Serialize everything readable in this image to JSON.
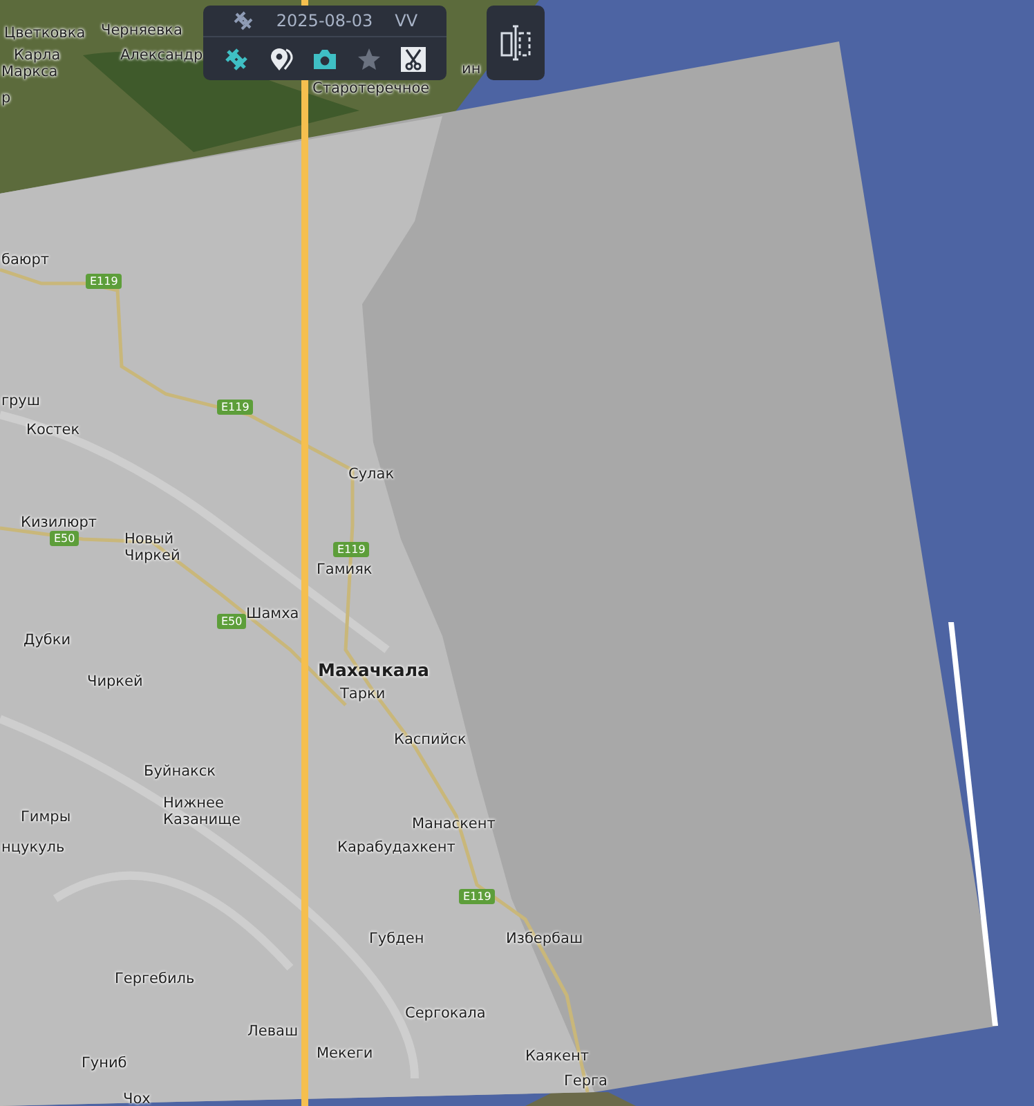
{
  "toolbar": {
    "date": "2025-08-03",
    "polarization": "VV",
    "tools": [
      {
        "kind": "satellite",
        "on": true,
        "disabled": false
      },
      {
        "kind": "pins",
        "on": false,
        "disabled": false
      },
      {
        "kind": "camera",
        "on": true,
        "disabled": false
      },
      {
        "kind": "star",
        "on": false,
        "disabled": true
      },
      {
        "kind": "scissors",
        "on": false,
        "disabled": false
      }
    ]
  },
  "map": {
    "labels": [
      {
        "kind": "town",
        "text": "Цветковка"
      },
      {
        "kind": "town",
        "text": "Черняевка"
      },
      {
        "kind": "town",
        "text": "Карла"
      },
      {
        "kind": "town",
        "text": "Маркса"
      },
      {
        "kind": "town",
        "text": "Александр"
      },
      {
        "kind": "town",
        "text": "р"
      },
      {
        "kind": "town",
        "text": "Старотеречное"
      },
      {
        "kind": "town",
        "text": "ин"
      },
      {
        "kind": "town",
        "text": "баюрт"
      },
      {
        "kind": "road",
        "text": "E119"
      },
      {
        "kind": "road",
        "text": "E119"
      },
      {
        "kind": "town",
        "text": "груш"
      },
      {
        "kind": "town",
        "text": "Костек"
      },
      {
        "kind": "town",
        "text": "Сулак"
      },
      {
        "kind": "town",
        "text": "Кизилюрт"
      },
      {
        "kind": "road",
        "text": "E50"
      },
      {
        "kind": "town",
        "text": "Новый Чиркей"
      },
      {
        "kind": "road",
        "text": "E119"
      },
      {
        "kind": "town",
        "text": "Гамияк"
      },
      {
        "kind": "town",
        "text": "Шамха"
      },
      {
        "kind": "road",
        "text": "E50"
      },
      {
        "kind": "town",
        "text": "Дубки"
      },
      {
        "kind": "city",
        "text": "Махачкала"
      },
      {
        "kind": "town",
        "text": "Чиркей"
      },
      {
        "kind": "town",
        "text": "Тарки"
      },
      {
        "kind": "town",
        "text": "Каспийск"
      },
      {
        "kind": "town",
        "text": "Буйнакск"
      },
      {
        "kind": "town",
        "text": "Гимры"
      },
      {
        "kind": "town",
        "text": "Нижнее Казанище"
      },
      {
        "kind": "town",
        "text": "Манаскент"
      },
      {
        "kind": "town",
        "text": "нцукуль"
      },
      {
        "kind": "town",
        "text": "Карабудахкент"
      },
      {
        "kind": "road",
        "text": "E119"
      },
      {
        "kind": "town",
        "text": "Губден"
      },
      {
        "kind": "town",
        "text": "Избербаш"
      },
      {
        "kind": "town",
        "text": "Гергебиль"
      },
      {
        "kind": "town",
        "text": "Сергокала"
      },
      {
        "kind": "town",
        "text": "Леваш"
      },
      {
        "kind": "town",
        "text": "Мекеги"
      },
      {
        "kind": "town",
        "text": "Гуниб"
      },
      {
        "kind": "town",
        "text": "Каякент"
      },
      {
        "kind": "town",
        "text": "Герга"
      },
      {
        "kind": "town",
        "text": "Чох"
      }
    ]
  }
}
